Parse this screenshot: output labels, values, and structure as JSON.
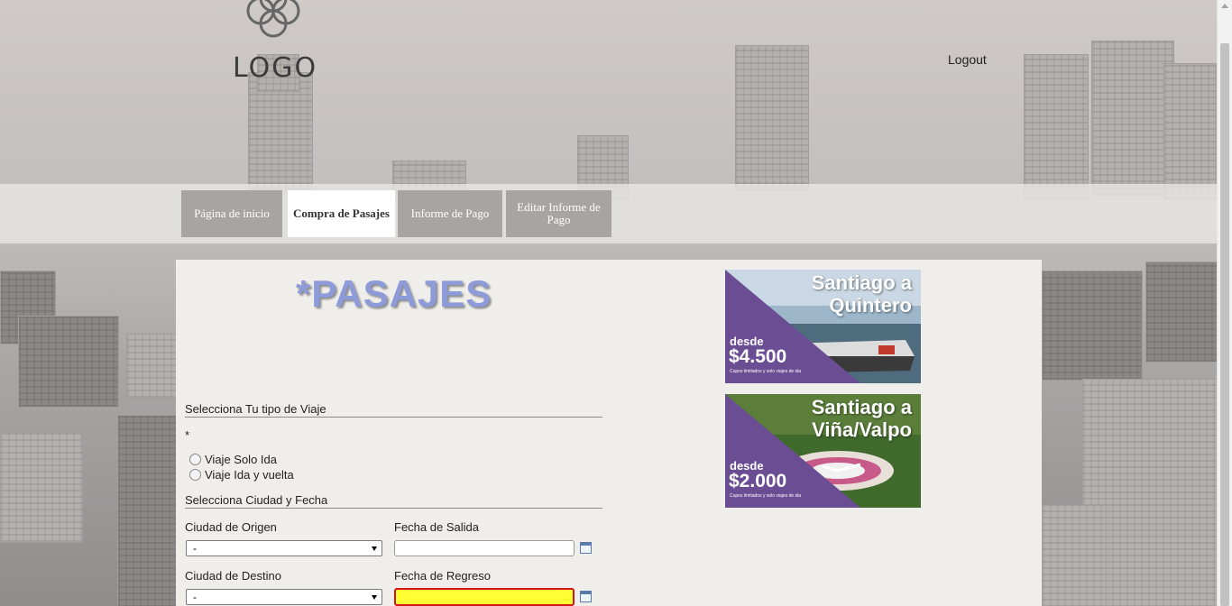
{
  "header": {
    "logo_text": "LOGO",
    "logout_label": "Logout"
  },
  "nav": {
    "tabs": [
      {
        "label": "Página de inicio",
        "active": false
      },
      {
        "label": "Compra de Pasajes",
        "active": true
      },
      {
        "label": "Informe de Pago",
        "active": false
      },
      {
        "label": "Editar Informe de Pago",
        "active": false
      }
    ]
  },
  "main": {
    "title": "*PASAJES",
    "trip_type_section": "Selecciona Tu tipo de Viaje",
    "required_mark": "*",
    "trip_options": [
      "Viaje Solo Ida",
      "Viaje Ida y vuelta"
    ],
    "city_date_section": "Selecciona Ciudad y Fecha",
    "origin_label": "Ciudad de Origen",
    "origin_value": "-",
    "departure_label": "Fecha de Salida",
    "departure_value": "",
    "destination_label": "Ciudad de Destino",
    "destination_value": "-",
    "return_label": "Fecha de Regreso",
    "return_value": ""
  },
  "promos": [
    {
      "title": "Santiago a Quintero",
      "desde": "desde",
      "price": "$4.500",
      "fine_print": "Cupos limitados y solo viajes de ida"
    },
    {
      "title": "Santiago a Viña/Valpo",
      "desde": "desde",
      "price": "$2.000",
      "fine_print": "Cupos limitados y solo viajes de ida"
    }
  ],
  "colors": {
    "title": "#8d9bd9",
    "tab_inactive": "#a8a4a3",
    "tab_active": "#ffffff",
    "content_bg": "#efeeea",
    "promo_purple": "#6a4d93",
    "highlight_field": "#ffff33",
    "highlight_border": "#d01818"
  }
}
